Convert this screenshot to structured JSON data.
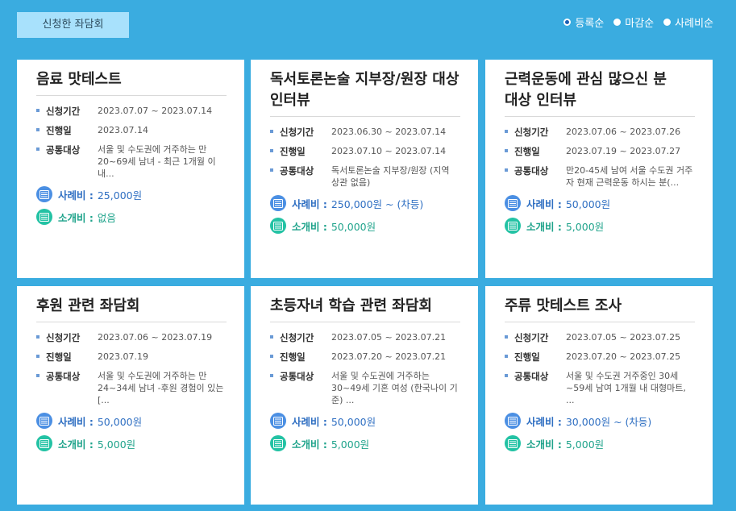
{
  "top_button": "신청한 좌담회",
  "sort": {
    "options": [
      {
        "label": "등록순",
        "selected": true
      },
      {
        "label": "마감순",
        "selected": false
      },
      {
        "label": "사례비순",
        "selected": false
      }
    ]
  },
  "labels": {
    "period": "신청기간",
    "date": "진행일",
    "target": "공통대상",
    "pay": "사례비 :",
    "referral": "소개비 :"
  },
  "cards": [
    {
      "title": "음료 맛테스트",
      "period": "2023.07.07 ~ 2023.07.14",
      "date": "2023.07.14",
      "target": "서울 및 수도권에 거주하는 만 20~69세 남녀 - 최근 1개월 이내...",
      "pay": "25,000원",
      "referral": "없음"
    },
    {
      "title": "독서토론논술 지부장/원장 대상 인터뷰",
      "period": "2023.06.30 ~ 2023.07.14",
      "date": "2023.07.10 ~ 2023.07.14",
      "target": "독서토론논술 지부장/원장 (지역 상관 없음)",
      "pay": "250,000원 ~ (차등)",
      "referral": "50,000원"
    },
    {
      "title": "근력운동에 관심 많으신 분 대상 인터뷰",
      "period": "2023.07.06 ~ 2023.07.26",
      "date": "2023.07.19 ~ 2023.07.27",
      "target": "만20-45세 남여 서울 수도권 거주자 현재 근력운동 하시는 분(...",
      "pay": "50,000원",
      "referral": "5,000원"
    },
    {
      "title": "후원 관련 좌담회",
      "period": "2023.07.06 ~ 2023.07.19",
      "date": "2023.07.19",
      "target": "서울 및 수도권에 거주하는 만 24~34세 남녀 -후원 경험이 있는 [...",
      "pay": "50,000원",
      "referral": "5,000원"
    },
    {
      "title": "초등자녀 학습 관련 좌담회",
      "period": "2023.07.05 ~ 2023.07.21",
      "date": "2023.07.20 ~ 2023.07.21",
      "target": "서울 및 수도권에 거주하는 30~49세 기혼 여성 (한국나이 기준) ...",
      "pay": "50,000원",
      "referral": "5,000원"
    },
    {
      "title": "주류 맛테스트 조사",
      "period": "2023.07.05 ~ 2023.07.25",
      "date": "2023.07.20 ~ 2023.07.25",
      "target": "서울 및 수도권 거주중인 30세~59세 남여 1개월 내 대형마트, ...",
      "pay": "30,000원 ~ (차등)",
      "referral": "5,000원"
    }
  ]
}
